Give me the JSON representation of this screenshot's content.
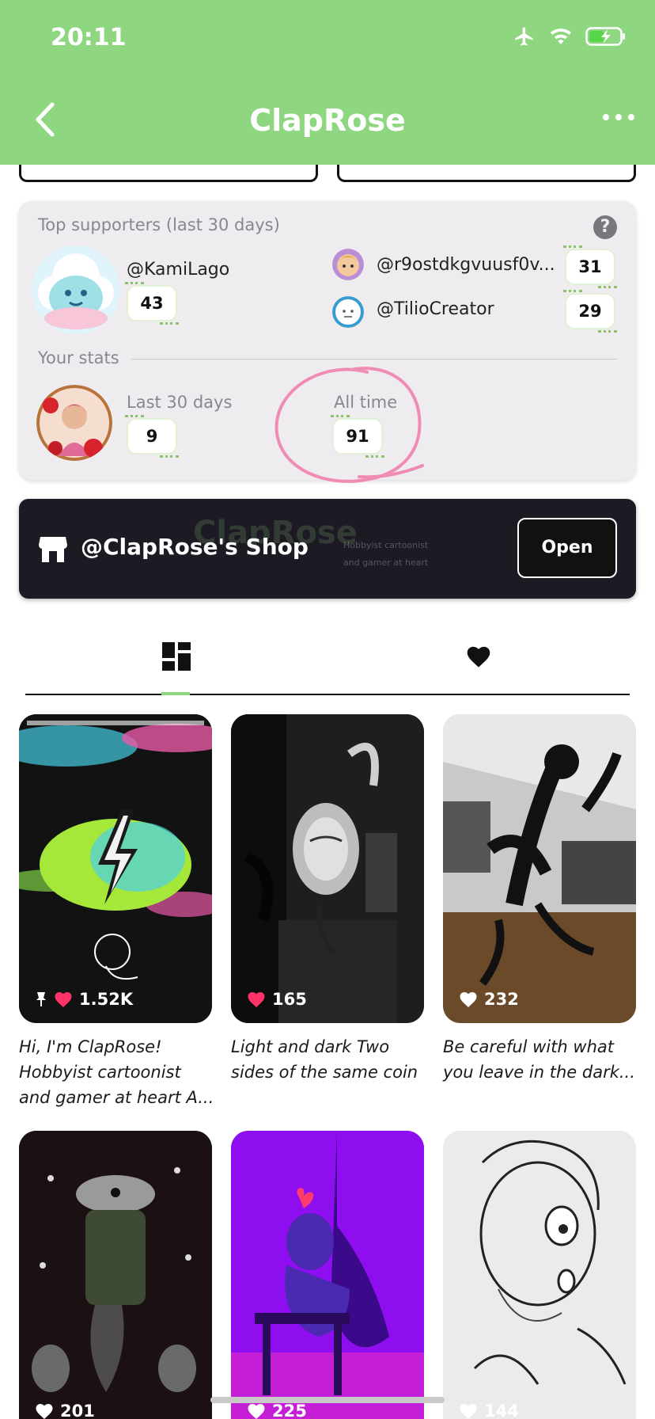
{
  "status_bar": {
    "time": "20:11"
  },
  "header": {
    "title": "ClapRose"
  },
  "supporters": {
    "heading": "Top supporters (last 30 days)",
    "help_glyph": "?",
    "top": {
      "handle": "@KamiLago",
      "count": "43"
    },
    "others": [
      {
        "handle": "@r9ostdkgvuusf0v...",
        "count": "31"
      },
      {
        "handle": "@TilioCreator",
        "count": "29"
      }
    ],
    "stats_heading": "Your stats",
    "last30_label": "Last 30 days",
    "last30_value": "9",
    "alltime_label": "All time",
    "alltime_value": "91"
  },
  "shop": {
    "name": "@ClapRose's Shop",
    "open_label": "Open",
    "bg_logo": "ClapRose",
    "bg_line1": "Hobbyist cartoonist",
    "bg_line2": "and gamer at heart"
  },
  "tabs": [
    {
      "icon": "dashboard-icon"
    },
    {
      "icon": "heart-icon"
    }
  ],
  "posts": [
    {
      "likes": "1.52K",
      "caption": "Hi, I'm ClapRose! Hobbyist cartoonist and gamer at heart A...",
      "pinned": true,
      "liked": true
    },
    {
      "likes": "165",
      "caption": "Light and dark Two sides of the same coin",
      "pinned": false,
      "liked": true
    },
    {
      "likes": "232",
      "caption": "Be careful with what you leave in the dark...",
      "pinned": false,
      "liked": false
    },
    {
      "likes": "201",
      "caption": "",
      "pinned": false,
      "liked": false
    },
    {
      "likes": "225",
      "caption": "",
      "pinned": false,
      "liked": false
    },
    {
      "likes": "144",
      "caption": "",
      "pinned": false,
      "liked": false
    }
  ],
  "colors": {
    "header": "#8fd680",
    "accent_like": "#ff3366",
    "annotation": "#f08cb4"
  }
}
